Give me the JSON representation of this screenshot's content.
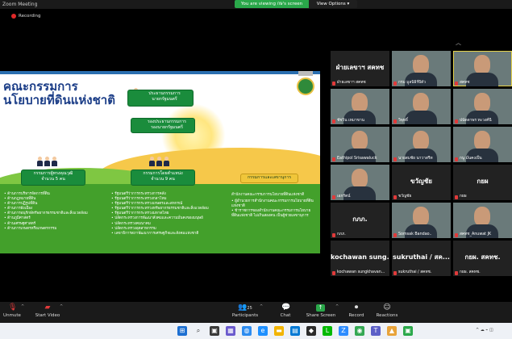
{
  "window": {
    "title": "Zoom Meeting"
  },
  "banner": {
    "viewing": "You are viewing กษ's screen",
    "options": "View Options ▾"
  },
  "recording": {
    "label": "Recording"
  },
  "slide": {
    "title_line1": "คณะกรรมการ",
    "title_line2": "นโยบายที่ดินแห่งชาติ",
    "chair": [
      "ประธานกรรมการ",
      "นายกรัฐมนตรี"
    ],
    "vice_chair": [
      "รองประธานกรรมการ",
      "รองนายกรัฐมนตรี"
    ],
    "box_left": [
      "กรรมการผู้ทรงคุณวุฒิ",
      "จำนวน 5 คน"
    ],
    "box_mid": [
      "กรรมการโดยตำแหน่ง",
      "จำนวน 9 คน"
    ],
    "box_right": "กรรมการและเลขานุการ",
    "list_left": [
      "ด้านการบริหารจัดการที่ดิน",
      "ด้านกฎหมายที่ดิน",
      "ด้านการปฏิรูปที่ดิน",
      "ด้านการผังเมือง",
      "ด้านการอนุรักษ์ทรัพยากรธรรมชาติและสิ่งแวดล้อม",
      "ด้านภูมิศาสตร์",
      "ด้านเศรษฐศาสตร์",
      "ด้านการเกษตรหรือเกษตรกรรม"
    ],
    "list_mid": [
      "รัฐมนตรีว่าการกระทรวงการคลัง",
      "รัฐมนตรีว่าการกระทรวงกลาโหม",
      "รัฐมนตรีว่าการกระทรวงเกษตรและสหกรณ์",
      "รัฐมนตรีว่าการกระทรวงทรัพยากรธรรมชาติและสิ่งแวดล้อม",
      "รัฐมนตรีว่าการกระทรวงมหาดไทย",
      "ปลัดกระทรวงการพัฒนาสังคมและความมั่นคงของมนุษย์",
      "ปลัดกระทรวงคมนาคม",
      "ปลัดกระทรวงอุตสาหกรรม",
      "เลขาธิการสภาพัฒนาการเศรษฐกิจและสังคมแห่งชาติ"
    ],
    "list_right_intro": "สำนักงานคณะกรรมการนโยบายที่ดินแห่งชาติ",
    "list_right": [
      "ผู้อำนวยการสำนักงานคณะกรรมการนโยบายที่ดินแห่งชาติ",
      "ข้าราชการของสำนักงานคณะกรรมการนโยบายที่ดินแห่งชาติ ไม่เกินสองคน เป็นผู้ช่วยเลขานุการ"
    ]
  },
  "participants": [
    {
      "name": "ฝ่ายเลขาฯ สคทช",
      "big": "ฝ่ายเลขาฯ สคทช",
      "video": false
    },
    {
      "name": "กรม  มูลนิธิร์ปิดัว",
      "big": "",
      "video": true
    },
    {
      "name": "สคทช",
      "big": "",
      "video": true,
      "active": true
    },
    {
      "name": "ชัชวิน เหมาขาน",
      "big": "",
      "video": true
    },
    {
      "name": "วิพุทธิ์",
      "big": "",
      "video": true
    },
    {
      "name": "ปนัดดาพร ทะวงศ์นี",
      "big": "",
      "video": true
    },
    {
      "name": "Eathipol Srisawaluck",
      "big": "",
      "video": true
    },
    {
      "name": "นายสมชัย นาวาสรีท",
      "big": "",
      "video": true
    },
    {
      "name": "กนู  มั่นคงเป็น",
      "big": "",
      "video": true
    },
    {
      "name": "เอกรัตน์",
      "big": "",
      "video": true
    },
    {
      "name": "ขวัญชัย",
      "big": "ขวัญชัย",
      "video": false
    },
    {
      "name": "กยผ",
      "big": "กยผ",
      "video": false
    },
    {
      "name": "กภภ.",
      "big": "กภภ.",
      "video": false
    },
    {
      "name": "Somsak Bandao..",
      "big": "",
      "video": true
    },
    {
      "name": "สคทช_Anuwat JK",
      "big": "",
      "video": true
    },
    {
      "name": "kochawan sungkhavan...",
      "big": "kochawan sung...",
      "video": false
    },
    {
      "name": "sukruthai / สคทช.",
      "big": "sukruthai / สค...",
      "video": false
    },
    {
      "name": "กยผ. สคทช.",
      "big": "กยผ. สคทช.",
      "video": false
    }
  ],
  "toolbar": {
    "unmute": "Unmute",
    "start_video": "Start Video",
    "participants": "Participants",
    "participants_count": "25",
    "chat": "Chat",
    "share_screen": "Share Screen",
    "record": "Record",
    "reactions": "Reactions"
  }
}
